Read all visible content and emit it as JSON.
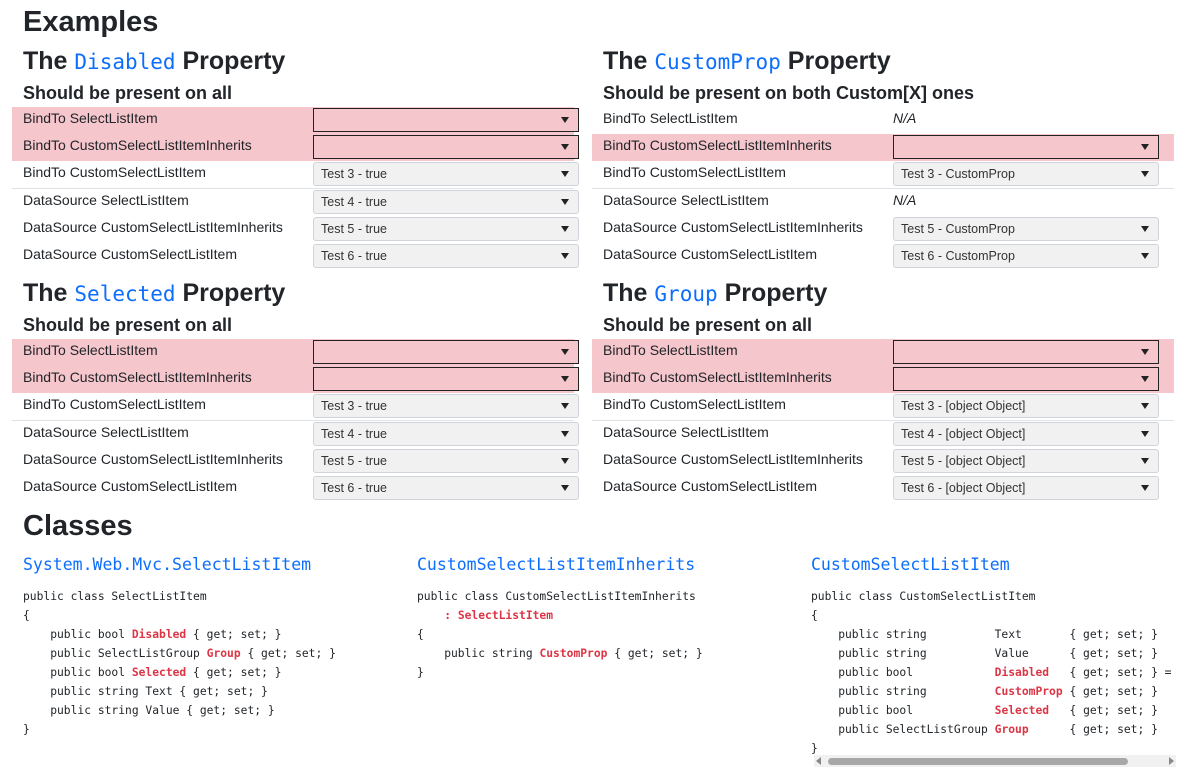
{
  "heading_examples": "Examples",
  "heading_classes": "Classes",
  "panels": [
    {
      "title_pre": "The ",
      "title_code": "Disabled",
      "title_post": " Property",
      "subtitle": "Should be present on all",
      "rows": [
        {
          "label": "BindTo SelectListItem",
          "select": ""
        },
        {
          "label": "BindTo CustomSelectListItemInherits",
          "select": ""
        },
        {
          "label": "BindTo CustomSelectListItem",
          "select": "Test 3 - true"
        },
        {
          "label": "DataSource SelectListItem",
          "select": "Test 4 - true"
        },
        {
          "label": "DataSource CustomSelectListItemInherits",
          "select": "Test 5 - true"
        },
        {
          "label": "DataSource CustomSelectListItem",
          "select": "Test 6 - true"
        }
      ]
    },
    {
      "title_pre": "The ",
      "title_code": "CustomProp",
      "title_post": " Property",
      "subtitle": "Should be present on both Custom[X] ones",
      "rows": [
        {
          "label": "BindTo SelectListItem",
          "value": "N/A"
        },
        {
          "label": "BindTo CustomSelectListItemInherits",
          "select": ""
        },
        {
          "label": "BindTo CustomSelectListItem",
          "select": "Test 3 - CustomProp"
        },
        {
          "label": "DataSource SelectListItem",
          "value": "N/A"
        },
        {
          "label": "DataSource CustomSelectListItemInherits",
          "select": "Test 5 - CustomProp"
        },
        {
          "label": "DataSource CustomSelectListItem",
          "select": "Test 6 - CustomProp"
        }
      ]
    },
    {
      "title_pre": "The ",
      "title_code": "Selected",
      "title_post": " Property",
      "subtitle": "Should be present on all",
      "rows": [
        {
          "label": "BindTo SelectListItem",
          "select": ""
        },
        {
          "label": "BindTo CustomSelectListItemInherits",
          "select": ""
        },
        {
          "label": "BindTo CustomSelectListItem",
          "select": "Test 3 - true"
        },
        {
          "label": "DataSource SelectListItem",
          "select": "Test 4 - true"
        },
        {
          "label": "DataSource CustomSelectListItemInherits",
          "select": "Test 5 - true"
        },
        {
          "label": "DataSource CustomSelectListItem",
          "select": "Test 6 - true"
        }
      ]
    },
    {
      "title_pre": "The ",
      "title_code": "Group",
      "title_post": " Property",
      "subtitle": "Should be present on all",
      "rows": [
        {
          "label": "BindTo SelectListItem",
          "select": ""
        },
        {
          "label": "BindTo CustomSelectListItemInherits",
          "select": ""
        },
        {
          "label": "BindTo CustomSelectListItem",
          "select": "Test 3 - [object Object]"
        },
        {
          "label": "DataSource SelectListItem",
          "select": "Test 4 - [object Object]"
        },
        {
          "label": "DataSource CustomSelectListItemInherits",
          "select": "Test 5 - [object Object]"
        },
        {
          "label": "DataSource CustomSelectListItem",
          "select": "Test 6 - [object Object]"
        }
      ]
    }
  ],
  "classes": [
    {
      "title": "System.Web.Mvc.SelectListItem",
      "lines": [
        [
          [
            "public class SelectListItem",
            ""
          ]
        ],
        [
          [
            "{",
            ""
          ]
        ],
        [
          [
            "    public bool ",
            ""
          ],
          [
            "Disabled",
            "kw"
          ],
          [
            " { get; set; }",
            ""
          ]
        ],
        [
          [
            "    public SelectListGroup ",
            ""
          ],
          [
            "Group",
            "kw"
          ],
          [
            " { get; set; }",
            ""
          ]
        ],
        [
          [
            "    public bool ",
            ""
          ],
          [
            "Selected",
            "kw"
          ],
          [
            " { get; set; }",
            ""
          ]
        ],
        [
          [
            "    public string Text { get; set; }",
            ""
          ]
        ],
        [
          [
            "    public string Value { get; set; }",
            ""
          ]
        ],
        [
          [
            "}",
            ""
          ]
        ]
      ]
    },
    {
      "title": "CustomSelectListItemInherits",
      "lines": [
        [
          [
            "public class CustomSelectListItemInherits",
            ""
          ]
        ],
        [
          [
            "    ",
            ""
          ],
          [
            ": SelectListItem",
            "kw"
          ]
        ],
        [
          [
            "{",
            ""
          ]
        ],
        [
          [
            "    public string ",
            ""
          ],
          [
            "CustomProp",
            "kw"
          ],
          [
            " { get; set; }",
            ""
          ]
        ],
        [
          [
            "}",
            ""
          ]
        ]
      ]
    },
    {
      "title": "CustomSelectListItem",
      "lines": [
        [
          [
            "public class CustomSelectListItem",
            ""
          ]
        ],
        [
          [
            "{",
            ""
          ]
        ],
        [
          [
            "    public string          Text       { get; set; }",
            ""
          ]
        ],
        [
          [
            "    public string          Value      { get; set; }",
            ""
          ]
        ],
        [
          [
            "    public bool            ",
            ""
          ],
          [
            "Disabled",
            "kw"
          ],
          [
            "   { get; set; } = false;",
            ""
          ]
        ],
        [
          [
            "    public string          ",
            ""
          ],
          [
            "CustomProp",
            "kw"
          ],
          [
            " { get; set; }",
            ""
          ]
        ],
        [
          [
            "    public bool            ",
            ""
          ],
          [
            "Selected",
            "kw"
          ],
          [
            "   { get; set; }",
            ""
          ]
        ],
        [
          [
            "    public SelectListGroup ",
            ""
          ],
          [
            "Group",
            "kw"
          ],
          [
            "      { get; set; }",
            ""
          ]
        ],
        [
          [
            "}",
            ""
          ]
        ]
      ]
    }
  ]
}
